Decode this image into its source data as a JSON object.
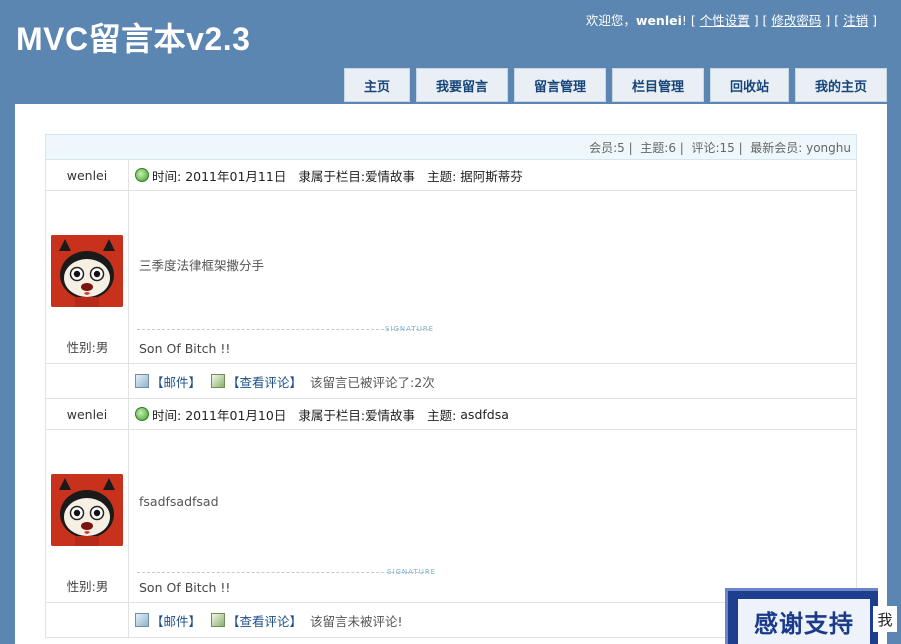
{
  "header": {
    "logo": "MVC留言本v2.3",
    "welcome_prefix": "欢迎您，",
    "username": "wenlei",
    "welcome_suffix": "!",
    "links": [
      "个性设置",
      "修改密码",
      "注销"
    ]
  },
  "nav": {
    "tabs": [
      "主页",
      "我要留言",
      "留言管理",
      "栏目管理",
      "回收站",
      "我的主页"
    ]
  },
  "stats": {
    "text": "会员:5 |  主题:6 |  评论:15 |  最新会员: yonghu"
  },
  "posts": [
    {
      "author": "wenlei",
      "time_label": "时间:",
      "time": "2011年01月11日",
      "category_label": "隶属于栏目:",
      "category": "爱情故事",
      "subject_label": "主题:",
      "subject": "据阿斯蒂芬",
      "body": "三季度法律框架撒分手",
      "gender": "性别:男",
      "signature_tag": "SIGNATURE",
      "signature": "Son Of Bitch !!",
      "mail_label": "【邮件】",
      "comments_label": "【查看评论】",
      "comment_status": "该留言已被评论了:2次"
    },
    {
      "author": "wenlei",
      "time_label": "时间:",
      "time": "2011年01月10日",
      "category_label": "隶属于栏目:",
      "category": "爱情故事",
      "subject_label": "主题:",
      "subject": "asdfdsa",
      "body": "fsadfsadfsad",
      "gender": "性别:男",
      "signature_tag": "SIGNATURE",
      "signature": "Son Of Bitch !!",
      "mail_label": "【邮件】",
      "comments_label": "【查看评论】",
      "comment_status": "该留言未被评论!"
    }
  ],
  "overlay": {
    "thanks": "感谢支持",
    "tail": "我"
  },
  "colors": {
    "background": "#5b86b1",
    "tab_text": "#16457a",
    "stats_bg": "#eef7fb"
  }
}
